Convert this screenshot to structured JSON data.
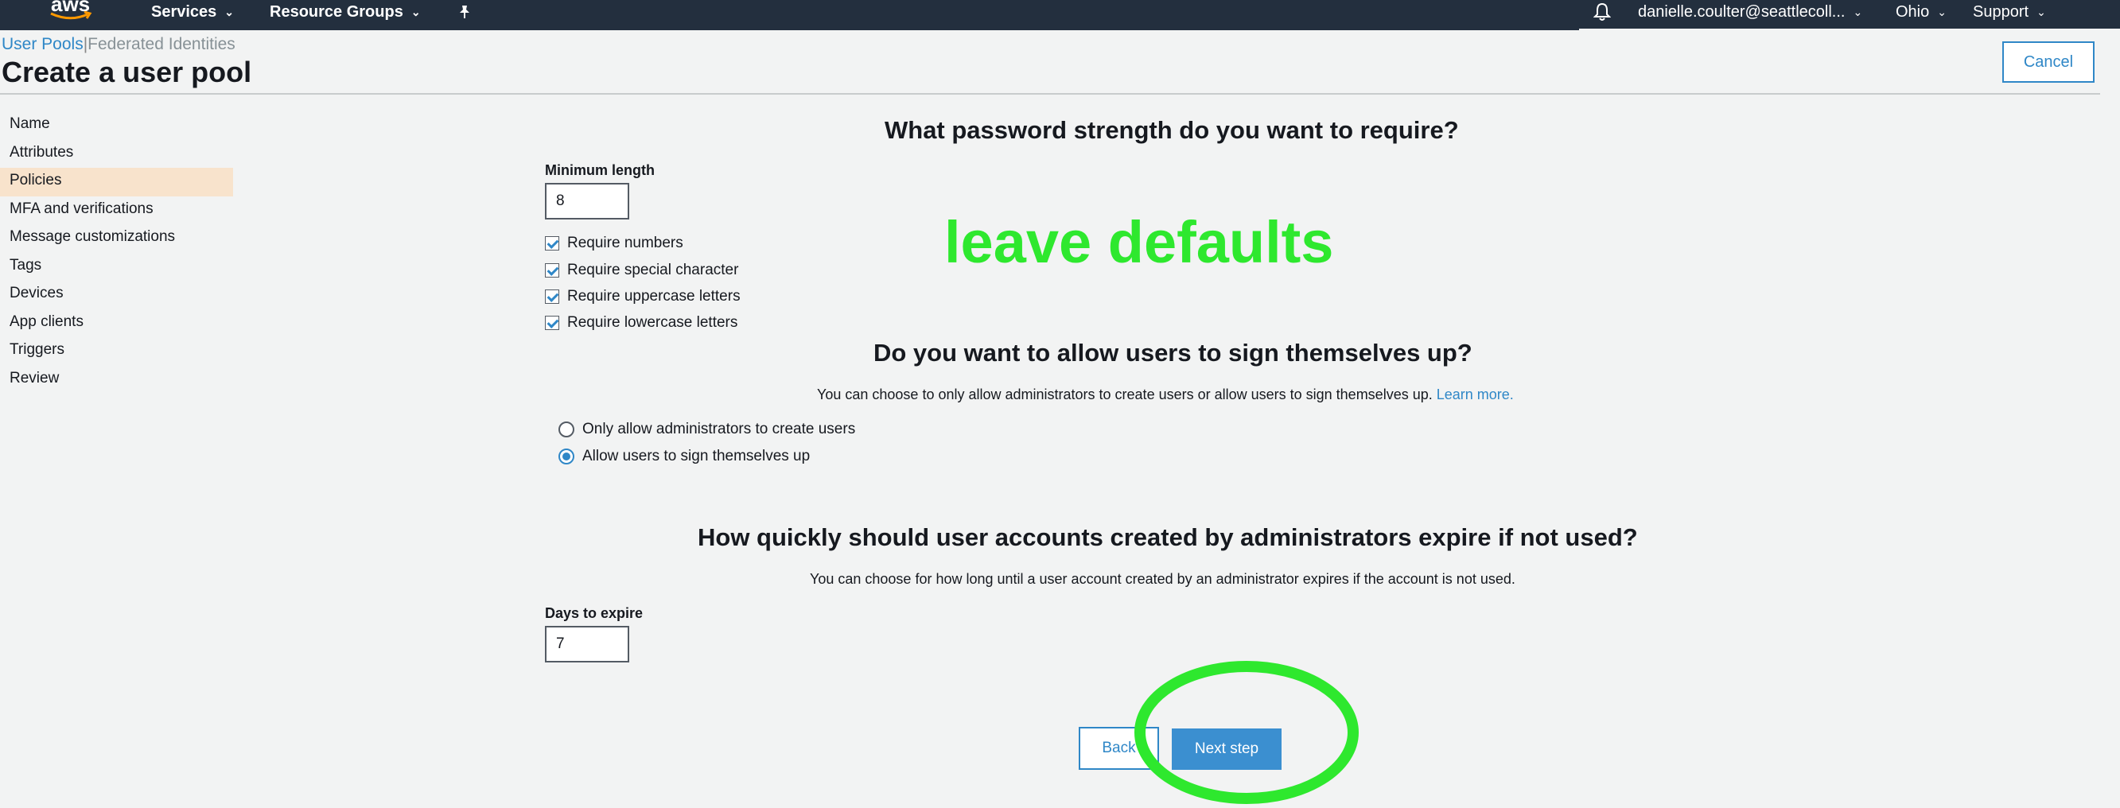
{
  "nav": {
    "logo_text": "aws",
    "services": "Services",
    "resource_groups": "Resource Groups",
    "user": "danielle.coulter@seattlecoll...",
    "region": "Ohio",
    "support": "Support"
  },
  "tabs": {
    "user_pools": "User Pools",
    "separator": "|",
    "federated": "Federated Identities"
  },
  "page_title": "Create a user pool",
  "cancel_label": "Cancel",
  "sidebar": {
    "items": [
      {
        "label": "Name"
      },
      {
        "label": "Attributes"
      },
      {
        "label": "Policies",
        "active": true
      },
      {
        "label": "MFA and verifications"
      },
      {
        "label": "Message customizations"
      },
      {
        "label": "Tags"
      },
      {
        "label": "Devices"
      },
      {
        "label": "App clients"
      },
      {
        "label": "Triggers"
      },
      {
        "label": "Review"
      }
    ]
  },
  "password": {
    "heading": "What password strength do you want to require?",
    "min_length_label": "Minimum length",
    "min_length_value": "8",
    "checkboxes": [
      {
        "label": "Require numbers",
        "checked": true
      },
      {
        "label": "Require special character",
        "checked": true
      },
      {
        "label": "Require uppercase letters",
        "checked": true
      },
      {
        "label": "Require lowercase letters",
        "checked": true
      }
    ]
  },
  "annotation": "leave defaults",
  "signup": {
    "heading": "Do you want to allow users to sign themselves up?",
    "desc": "You can choose to only allow administrators to create users or allow users to sign themselves up.",
    "learn_more": "Learn more.",
    "options": [
      {
        "label": "Only allow administrators to create users",
        "selected": false
      },
      {
        "label": "Allow users to sign themselves up",
        "selected": true
      }
    ]
  },
  "expire": {
    "heading": "How quickly should user accounts created by administrators expire if not used?",
    "desc": "You can choose for how long until a user account created by an administrator expires if the account is not used.",
    "days_label": "Days to expire",
    "days_value": "7"
  },
  "buttons": {
    "back": "Back",
    "next": "Next step"
  },
  "colors": {
    "nav_bg": "#232f3e",
    "accent": "#2f87c7",
    "active_side": "#f8e3cc",
    "annotation": "#2ee82e"
  }
}
